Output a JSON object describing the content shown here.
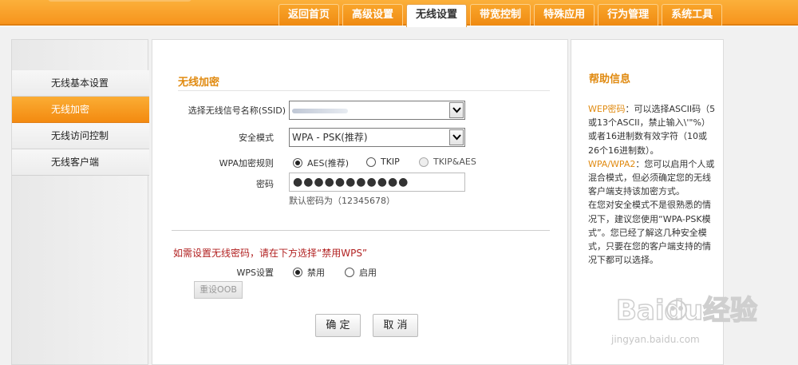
{
  "nav": {
    "tabs": [
      {
        "label": "返回首页"
      },
      {
        "label": "高级设置"
      },
      {
        "label": "无线设置"
      },
      {
        "label": "带宽控制"
      },
      {
        "label": "特殊应用"
      },
      {
        "label": "行为管理"
      },
      {
        "label": "系统工具"
      }
    ],
    "active_tab": "无线设置"
  },
  "sidebar": {
    "items": [
      {
        "label": "无线基本设置"
      },
      {
        "label": "无线加密"
      },
      {
        "label": "无线访问控制"
      },
      {
        "label": "无线客户端"
      }
    ],
    "active": "无线加密"
  },
  "form": {
    "title": "无线加密",
    "ssid_label": "选择无线信号名称(SSID)",
    "security_label": "安全模式",
    "security_value": "WPA - PSK(推荐)",
    "wpa_label": "WPA加密规则",
    "wpa_options": [
      {
        "label": "AES(推荐)",
        "checked": true
      },
      {
        "label": "TKIP",
        "checked": false
      },
      {
        "label": "TKIP&AES",
        "checked": false,
        "disabled": true
      }
    ],
    "password_label": "密码",
    "password_value": "●●●●●●●●●●●",
    "password_hint": "默认密码为（12345678）",
    "wps_warning": "如需设置无线密码，请在下方选择“禁用WPS”",
    "wps_label": "WPS设置",
    "wps_options": [
      {
        "label": "禁用",
        "checked": true
      },
      {
        "label": "启用",
        "checked": false
      }
    ],
    "reset_oob_label": "重设OOB",
    "ok_label": "确 定",
    "cancel_label": "取 消"
  },
  "help": {
    "title": "帮助信息",
    "wep_key": "WEP密码",
    "wep_text": "：可以选择ASCII码（5或13个ASCII，禁止输入\\'\"%）或者16进制数有效字符（10或26个16进制数）。",
    "wpa_key": "WPA/WPA2",
    "wpa_text": "：您可以启用个人或混合模式，但必须确定您的无线客户端支持该加密方式。",
    "tip_text": "在您对安全模式不是很熟悉的情况下，建议您使用“WPA-PSK模式”。您已经了解这几种安全模式，只要在您的客户端支持的情况下都可以选择。"
  },
  "watermark": {
    "brand": "Baidu经验",
    "url": "jingyan.baidu.com"
  },
  "colors": {
    "accent": "#f7941d",
    "title": "#e08a10",
    "warning": "#b22222"
  }
}
